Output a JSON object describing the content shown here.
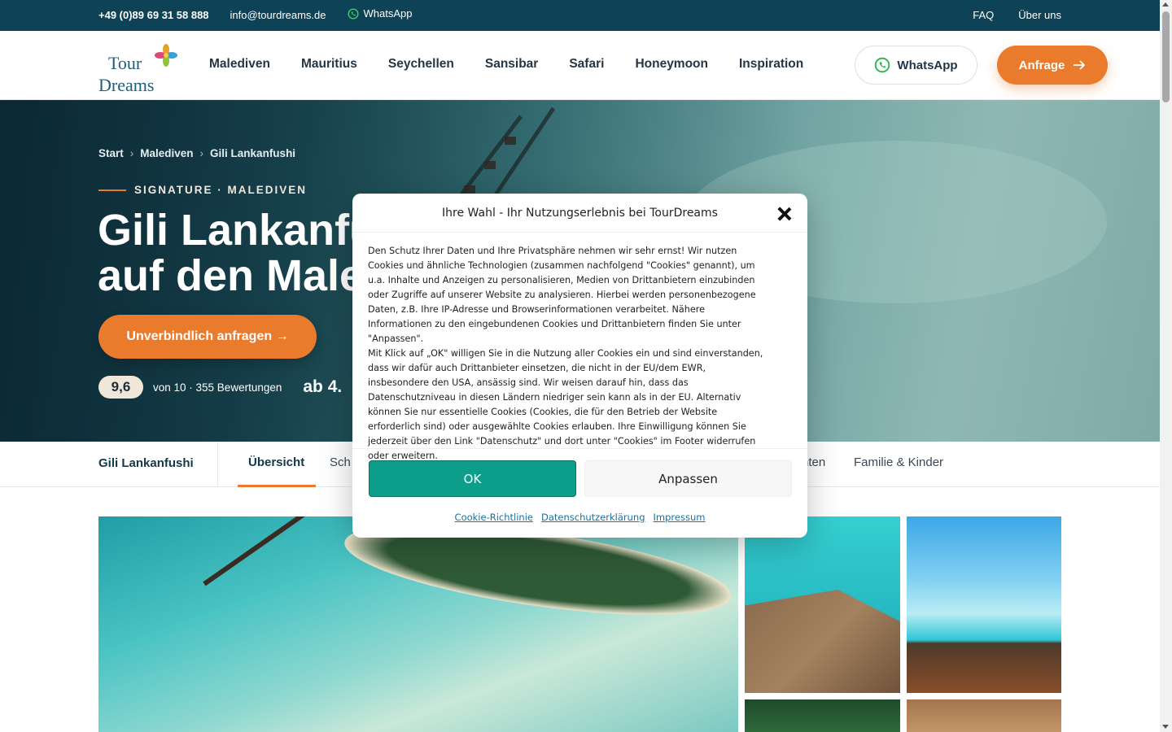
{
  "topbar": {
    "phone": "+49 (0)89 69 31 58 888",
    "email": "info@tourdreams.de",
    "whatsapp": "WhatsApp",
    "faq": "FAQ",
    "about": "Über uns"
  },
  "header": {
    "logo_line1": "Tour",
    "logo_line2": "Dreams",
    "nav": [
      "Malediven",
      "Mauritius",
      "Seychellen",
      "Sansibar",
      "Safari",
      "Honeymoon",
      "Inspiration"
    ],
    "whatsapp_button": "WhatsApp",
    "anfrage_button": "Anfrage"
  },
  "hero": {
    "breadcrumb": [
      "Start",
      "Malediven",
      "Gili Lankanfushi"
    ],
    "breadcrumb_sep": "›",
    "eyebrow": "SIGNATURE · MALEDIVEN",
    "title_line1": "Gili Lankanfushi",
    "title_line2": "auf den Malediven",
    "cta": "Unverbindlich anfragen →",
    "score": "9,6",
    "reviews": "von 10 · 355 Bewertungen",
    "price": "ab 4.",
    "colors": {
      "accent": "#ea7a2c",
      "dark": "#0e4257"
    }
  },
  "tabs": {
    "hotel_name": "Gili Lankanfushi",
    "items": [
      "Übersicht",
      "Sch",
      "nten",
      "Familie & Kinder"
    ],
    "active": "Übersicht"
  },
  "cookie_modal": {
    "title": "Ihre Wahl - Ihr Nutzungserlebnis bei TourDreams",
    "paragraph1": "Den Schutz Ihrer Daten und Ihre Privatsphäre nehmen wir sehr ernst! Wir nutzen Cookies und ähnliche Technologien (zusammen nachfolgend \"Cookies\" genannt), um u.a. Inhalte und Anzeigen zu personalisieren, Medien von Drittanbietern einzubinden oder Zugriffe auf unserer Website zu analysieren. Hierbei werden personenbezogene Daten, z.B. Ihre IP-Adresse und Browserinformationen verarbeitet. Nähere Informationen zu den eingebundenen Cookies und Drittanbietern finden Sie unter \"Anpassen\".",
    "paragraph2": "Mit Klick auf „OK\" willigen Sie in die Nutzung aller Cookies ein und sind einverstanden, dass wir dafür auch Drittanbieter einsetzen, die nicht in der EU/dem EWR, insbesondere den USA, ansässig sind. Wir weisen darauf hin, dass das Datenschutzniveau in diesen Ländern niedriger sein kann als in der EU. Alternativ können Sie nur essentielle Cookies (Cookies, die für den Betrieb der Website erforderlich sind) oder ausgewählte Cookies erlauben. Ihre Einwilligung können Sie jederzeit über den Link \"Datenschutz\" und dort unter \"Cookies\" im Footer widerrufen oder erweitern.",
    "ok_button": "OK",
    "adjust_button": "Anpassen",
    "links": [
      "Cookie-Richtlinie",
      "Datenschutzerklärung",
      "Impressum"
    ],
    "colors": {
      "ok": "#0d9e8b"
    }
  }
}
